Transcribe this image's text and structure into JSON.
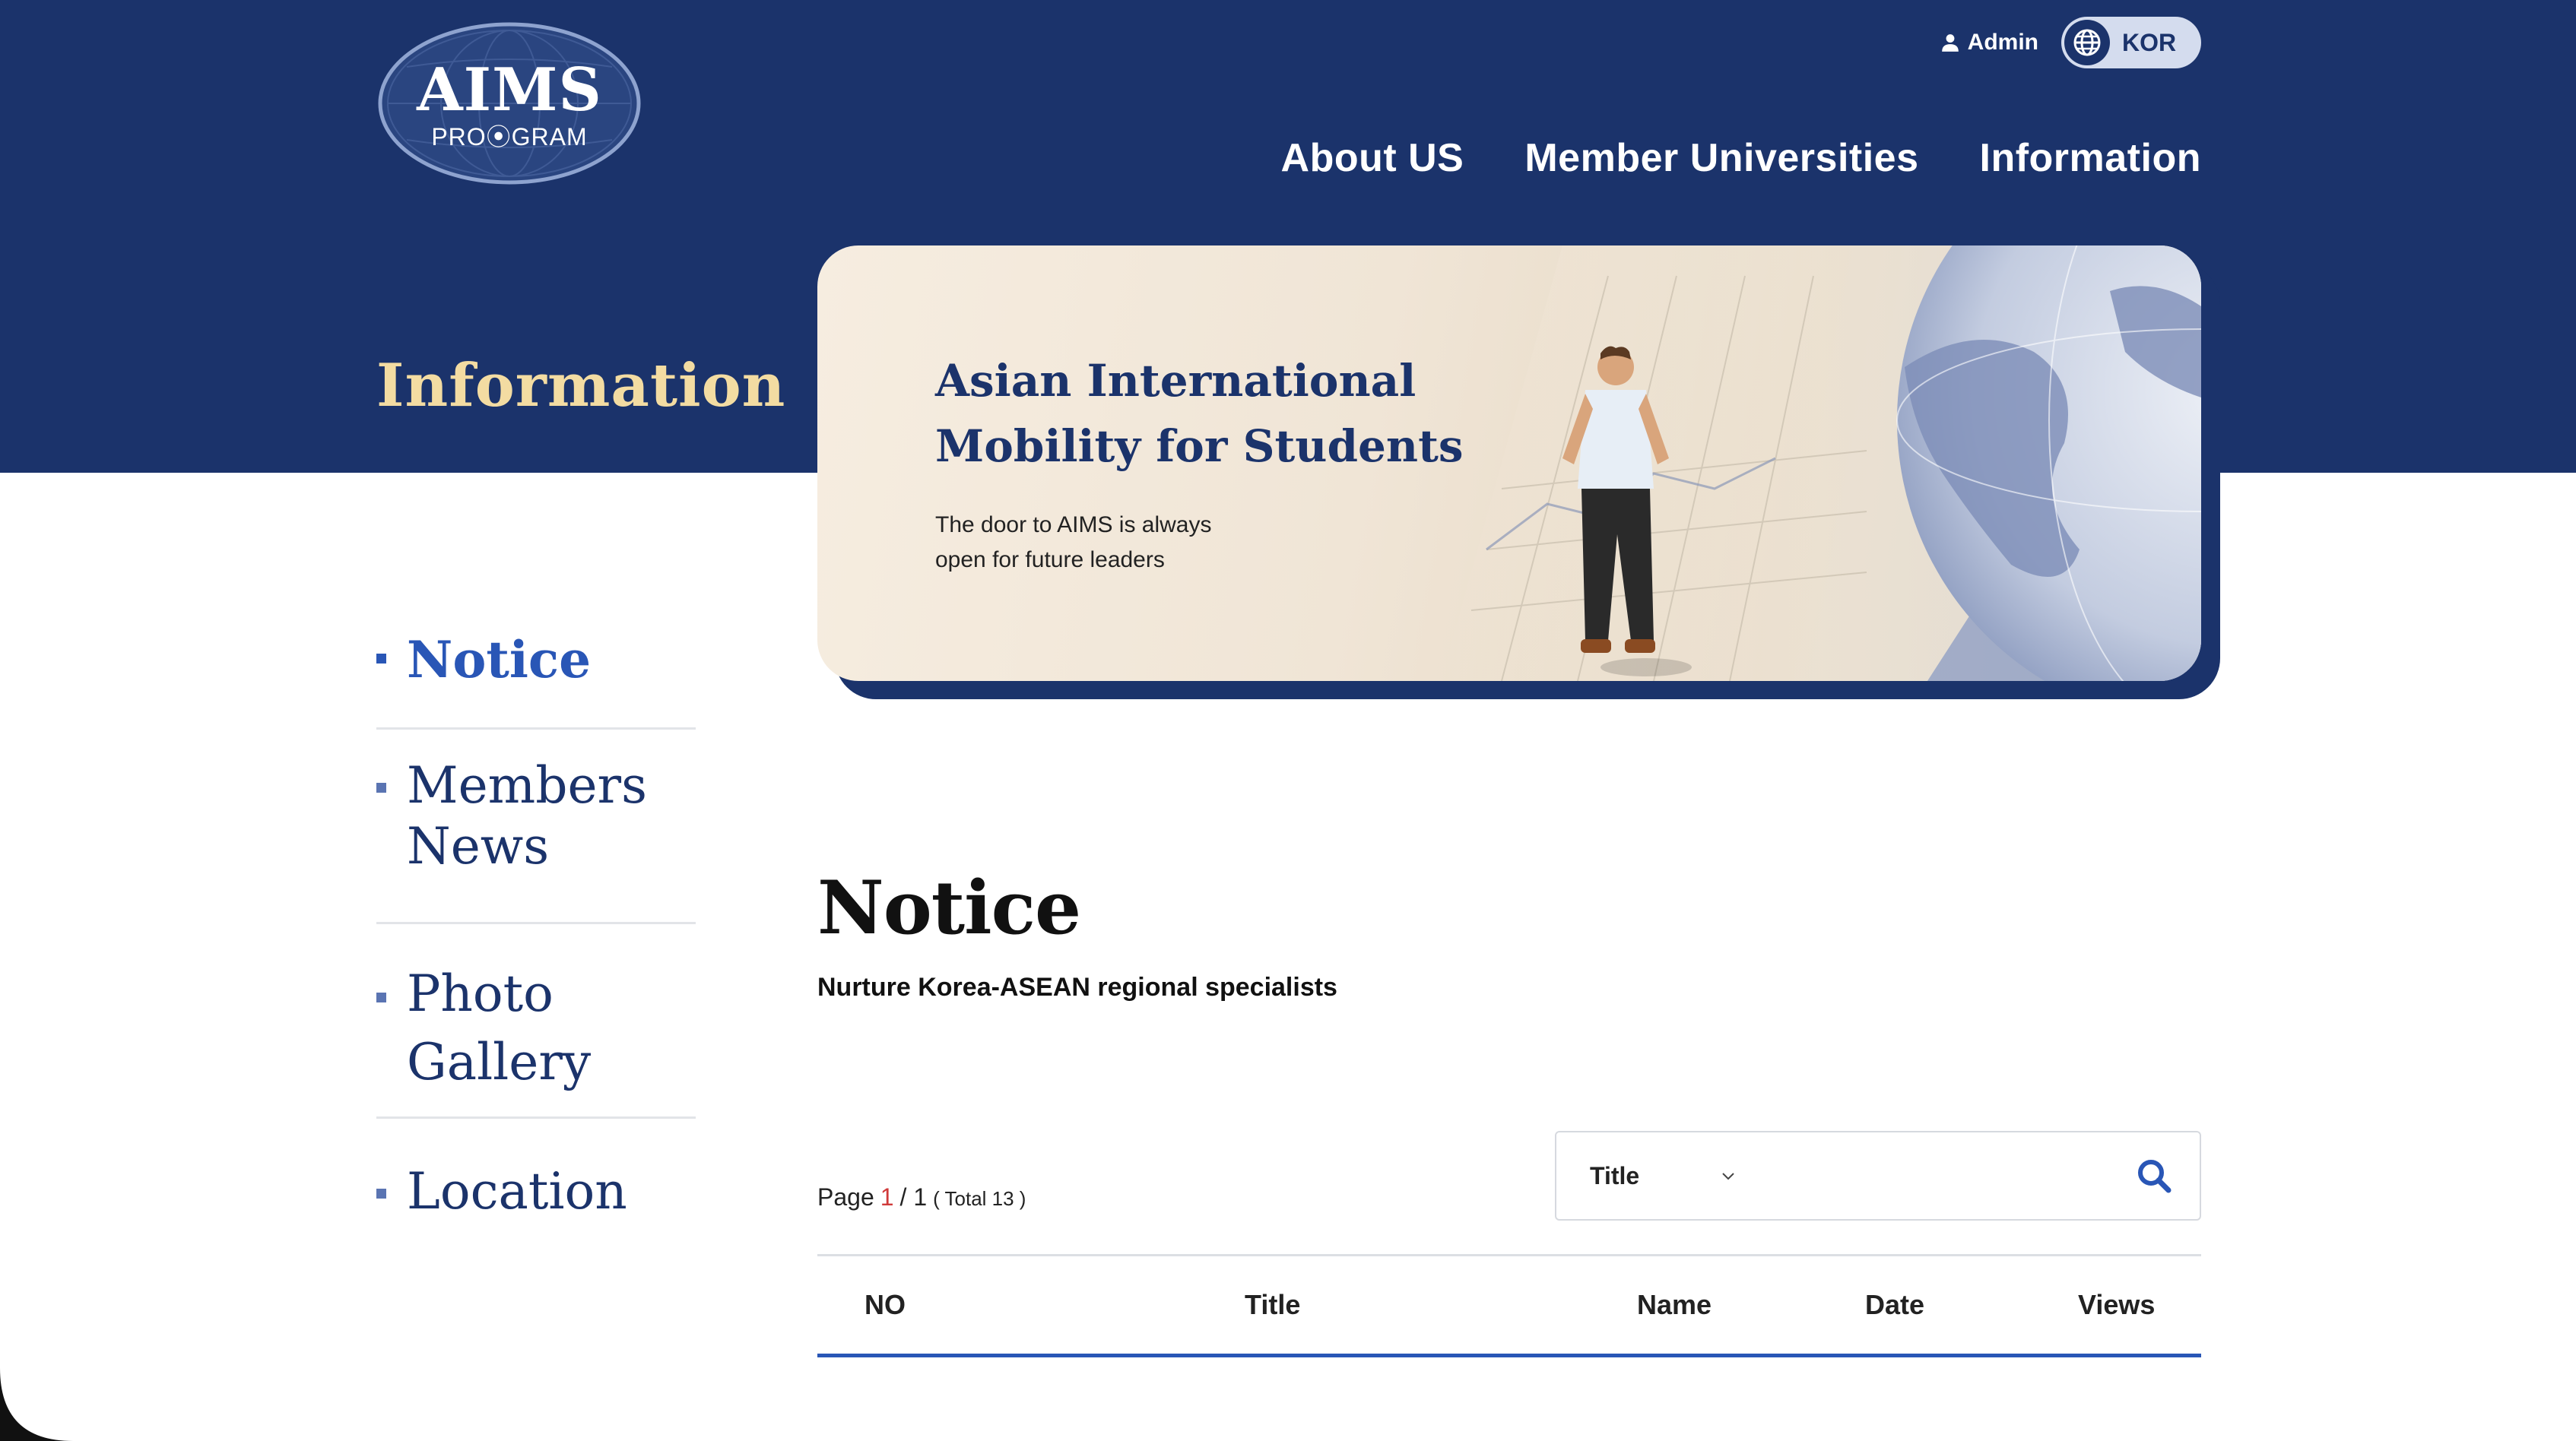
{
  "logo": {
    "main": "AIMS",
    "sub": "PRO⦿GRAM"
  },
  "top_utils": {
    "admin_label": "Admin",
    "lang_label": "KOR"
  },
  "nav": {
    "items": [
      {
        "label": "About US"
      },
      {
        "label": "Member Universities"
      },
      {
        "label": "Information"
      }
    ]
  },
  "section_heading": "Information",
  "hero": {
    "title_line1": "Asian International",
    "title_line2": "Mobility for Students",
    "sub_line1": "The door to AIMS is always",
    "sub_line2": "open for future leaders"
  },
  "side_nav": {
    "items": [
      {
        "line1": "Notice",
        "line2": "",
        "active": true
      },
      {
        "line1": "Members",
        "line2": "News",
        "active": false
      },
      {
        "line1": "Photo",
        "line2": "Gallery",
        "active": false
      },
      {
        "line1": "Location",
        "line2": "",
        "active": false
      }
    ]
  },
  "content": {
    "title": "Notice",
    "subtitle": "Nurture Korea-ASEAN regional specialists"
  },
  "pagination": {
    "page_word": "Page",
    "current": "1",
    "separator": "/ 1",
    "total": "( Total 13 )"
  },
  "search": {
    "select_value": "Title",
    "input_value": "",
    "placeholder": ""
  },
  "table": {
    "columns": [
      "NO",
      "Title",
      "Name",
      "Date",
      "Views"
    ]
  },
  "colors": {
    "navy": "#1b336b",
    "accent_blue": "#2956b6",
    "heading_gold": "#f3dca2",
    "current_page_red": "#d03a3a"
  },
  "icons": [
    "user-icon",
    "globe-icon",
    "chevron-down-icon",
    "search-icon"
  ]
}
